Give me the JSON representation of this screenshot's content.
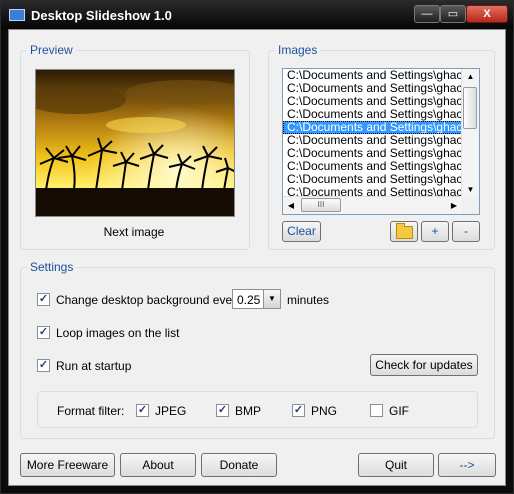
{
  "window": {
    "title": "Desktop Slideshow 1.0",
    "controls": {
      "minimize": "—",
      "maximize": "▭",
      "close": "X"
    }
  },
  "preview": {
    "label": "Preview",
    "next_image": "Next image"
  },
  "images": {
    "label": "Images",
    "items": [
      "C:\\Documents and Settings\\ghack\\D",
      "C:\\Documents and Settings\\ghack\\D",
      "C:\\Documents and Settings\\ghack\\D",
      "C:\\Documents and Settings\\ghack\\D",
      "C:\\Documents and Settings\\ghack\\D",
      "C:\\Documents and Settings\\ghack\\D",
      "C:\\Documents and Settings\\ghack\\D",
      "C:\\Documents and Settings\\ghack\\D",
      "C:\\Documents and Settings\\ghack\\D",
      "C:\\Documents and Settings\\ghack\\D"
    ],
    "selected_index": 4,
    "clear": "Clear",
    "add": "+",
    "remove": "-",
    "scroll": {
      "up": "▲",
      "down": "▼",
      "left": "◀",
      "right": "▶",
      "grip": "III"
    }
  },
  "settings": {
    "label": "Settings",
    "change_bg": "Change desktop background every",
    "interval_value": "0.25",
    "interval_dropdown": "▼",
    "interval_unit": "minutes",
    "loop": "Loop images on the list",
    "startup": "Run at startup",
    "check_updates": "Check for updates",
    "format_filter": "Format filter:",
    "formats": [
      {
        "name": "JPEG",
        "checked": true
      },
      {
        "name": "BMP",
        "checked": true
      },
      {
        "name": "PNG",
        "checked": true
      },
      {
        "name": "GIF",
        "checked": false
      }
    ],
    "check_mark": "✓"
  },
  "footer": {
    "more_freeware": "More Freeware",
    "about": "About",
    "donate": "Donate",
    "quit": "Quit",
    "next": "-->"
  }
}
